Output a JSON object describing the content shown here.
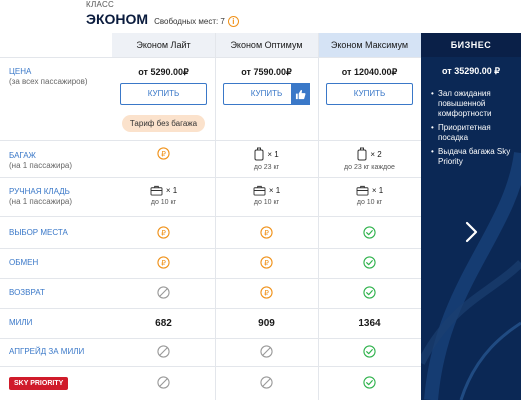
{
  "class_header": {
    "label": "КЛАСС",
    "name": "ЭКОНОМ",
    "seats_text": "Свободных мест: 7",
    "info_glyph": "i"
  },
  "tariffs": [
    {
      "name": "Эконом Лайт",
      "price": "от 5290.00₽",
      "buy_label": "КУПИТЬ",
      "note": "Тариф без багажа"
    },
    {
      "name": "Эконом Оптимум",
      "price": "от 7590.00₽",
      "buy_label": "КУПИТЬ",
      "note": ""
    },
    {
      "name": "Эконом Максимум",
      "price": "от 12040.00₽",
      "buy_label": "КУПИТЬ",
      "note": ""
    }
  ],
  "business": {
    "title": "БИЗНЕС",
    "price": "от 35290.00 ₽",
    "features": [
      "Зал ожидания повышенной комфортности",
      "Приоритетная посадка",
      "Выдача багажа Sky Priority"
    ]
  },
  "rows": {
    "price": {
      "label": "ЦЕНА",
      "sub": "(за всех пассажиров)"
    },
    "baggage": {
      "label": "БАГАЖ",
      "sub": "(на 1 пассажира)"
    },
    "hand": {
      "label": "РУЧНАЯ КЛАДЬ",
      "sub": "(на 1 пассажира)"
    },
    "seat": {
      "label": "ВЫБОР МЕСТА"
    },
    "exchange": {
      "label": "ОБМЕН"
    },
    "refund": {
      "label": "ВОЗВРАТ"
    },
    "miles": {
      "label": "МИЛИ"
    },
    "upgrade": {
      "label": "АПГРЕЙД ЗА МИЛИ"
    },
    "sky_priority": {
      "label": "SKY PRIORITY"
    }
  },
  "baggage": [
    {
      "icon": "paid-icon",
      "count": "",
      "note": ""
    },
    {
      "icon": "suitcase-icon",
      "count": "× 1",
      "note": "до 23 кг"
    },
    {
      "icon": "suitcase-icon",
      "count": "× 2",
      "note": "до 23 кг каждое"
    }
  ],
  "hand": [
    {
      "count": "× 1",
      "note": "до 10 кг"
    },
    {
      "count": "× 1",
      "note": "до 10 кг"
    },
    {
      "count": "× 1",
      "note": "до 10 кг"
    }
  ],
  "seat": [
    "paid-icon",
    "paid-icon",
    "included-icon"
  ],
  "exchange": [
    "paid-icon",
    "paid-icon",
    "included-icon"
  ],
  "refund": [
    "not-available-icon",
    "paid-icon",
    "included-icon"
  ],
  "miles": [
    "682",
    "909",
    "1364"
  ],
  "upgrade": [
    "not-available-icon",
    "not-available-icon",
    "included-icon"
  ],
  "sky_priority": [
    "not-available-icon",
    "not-available-icon",
    "included-icon"
  ],
  "colors": {
    "accent": "#3a78c8",
    "paid": "#f0921a",
    "included": "#2fb24c",
    "not_available": "#9a9a9a",
    "business_bg": "#0b2855",
    "sky_priority": "#d01b2a"
  }
}
